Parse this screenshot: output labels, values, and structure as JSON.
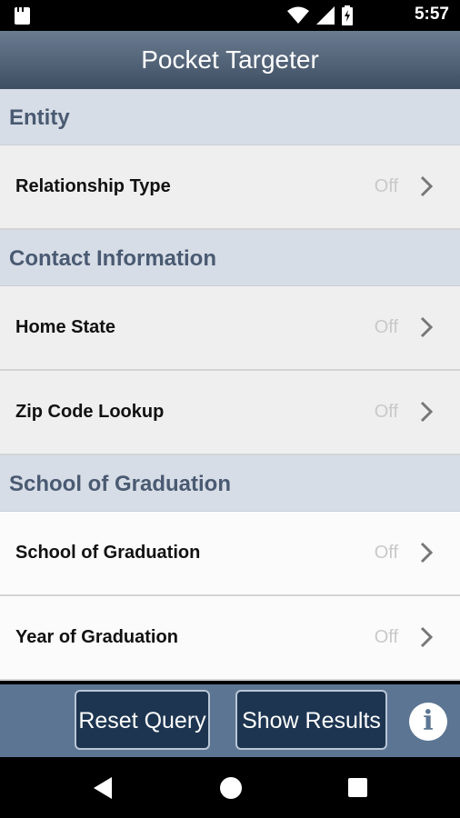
{
  "status_bar": {
    "time": "5:57",
    "icons": [
      "sd-card-icon",
      "wifi-icon",
      "signal-icon",
      "battery-icon"
    ]
  },
  "app_bar": {
    "title": "Pocket Targeter"
  },
  "sections": [
    {
      "header": "Entity",
      "rows": [
        {
          "label": "Relationship Type",
          "value": "Off"
        }
      ]
    },
    {
      "header": "Contact Information",
      "rows": [
        {
          "label": "Home State",
          "value": "Off"
        },
        {
          "label": "Zip Code Lookup",
          "value": "Off"
        }
      ]
    },
    {
      "header": "School of Graduation",
      "rows": [
        {
          "label": "School of Graduation",
          "value": "Off"
        },
        {
          "label": "Year of Graduation",
          "value": "Off"
        }
      ]
    }
  ],
  "toolbar": {
    "reset_label": "Reset Query",
    "show_label": "Show Results",
    "info_label": "i"
  },
  "colors": {
    "app_bar": "#52647a",
    "section_header_bg": "#d6dde6",
    "section_header_text": "#4a5a72",
    "toolbar": "#5c7593",
    "button": "#1d3551"
  }
}
